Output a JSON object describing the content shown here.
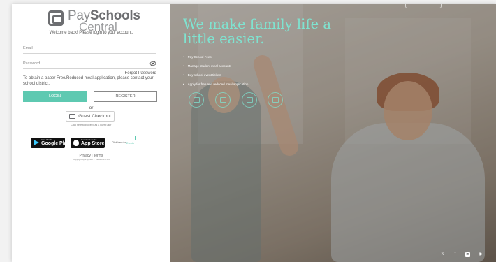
{
  "brand": {
    "pay": "Pay",
    "schools": "Schools",
    "central": "Central",
    "accent_color": "#5ec9b1",
    "headline_color": "#7fe3d0"
  },
  "login": {
    "welcome": "Welcome back! Please login to your account.",
    "email_label": "Email",
    "password_label": "Password",
    "forgot_password": "Forgot Password",
    "paper_note": "To obtain a paper Free/Reduced meal application, please contact your school district.",
    "login_button": "LOGIN",
    "register_button": "REGISTER",
    "or": "or",
    "guest_checkout": "Guest Checkout",
    "guest_hint": "Click here to proceed as a guest user"
  },
  "apps": {
    "google_small": "GET IT ON",
    "google_big": "Google Play",
    "apple_small": "Download on the",
    "apple_big": "App Store",
    "events_link": "Click here for",
    "events_logo": "Events"
  },
  "footer": {
    "legal": "Privacy | Terms",
    "copyright": "Copyright by PayKids ... Version 3.8.0.0"
  },
  "hero": {
    "headline": "We make family life a little easier.",
    "features": [
      "Pay School Fees",
      "Manage student meal accounts",
      "Buy school event tickets",
      "Apply for free and reduced meal application"
    ],
    "feature_icons": [
      "fees-icon",
      "meal-icon",
      "ticket-icon",
      "application-icon"
    ]
  },
  "social": [
    "twitter-icon",
    "facebook-icon",
    "linkedin-icon",
    "globe-icon"
  ]
}
